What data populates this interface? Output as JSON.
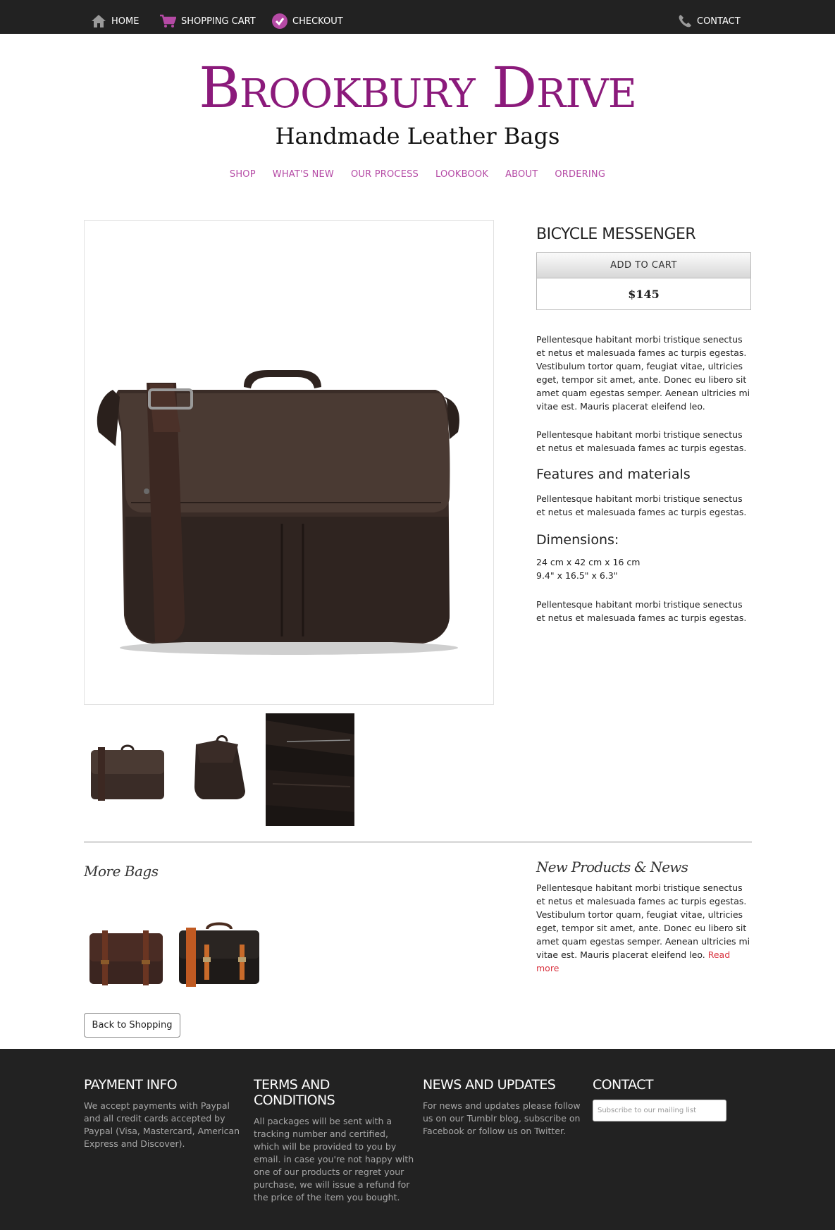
{
  "topnav": {
    "home": "HOME",
    "cart": "SHOPPING CART",
    "checkout": "CHECKOUT",
    "contact": "CONTACT"
  },
  "header": {
    "title": "Brookbury Drive",
    "subtitle": "Handmade Leather Bags"
  },
  "mainnav": [
    "SHOP",
    "WHAT'S NEW",
    "OUR PROCESS",
    "LOOKBOOK",
    "ABOUT",
    "ORDERING"
  ],
  "product": {
    "title": "BICYCLE MESSENGER",
    "add_to_cart": "ADD TO CART",
    "price": "$145",
    "para1": "Pellentesque habitant morbi tristique senectus et netus et malesuada fames ac turpis egestas. Vestibulum tortor quam, feugiat vitae, ultricies eget, tempor sit amet, ante. Donec eu libero sit amet quam egestas semper. Aenean ultricies mi vitae est. Mauris placerat eleifend leo.",
    "para2": "Pellentesque habitant morbi tristique senectus et netus et malesuada fames ac turpis egestas.",
    "features_heading": "Features and materials",
    "para3": "Pellentesque habitant morbi tristique senectus et netus et malesuada fames ac turpis egestas.",
    "dimensions_heading": "Dimensions:",
    "dim_metric": "24 cm x 42 cm x 16 cm",
    "dim_imperial": "9.4\" x 16.5\" x 6.3\"",
    "para4": "Pellentesque habitant morbi tristique senectus et netus et malesuada fames ac turpis egestas."
  },
  "more_bags": {
    "title": "More Bags",
    "back_button": "Back to Shopping"
  },
  "news": {
    "title": "New Products & News",
    "text": "Pellentesque habitant morbi tristique senectus et netus et malesuada fames ac turpis egestas. Vestibulum tortor quam, feugiat vitae, ultricies eget, tempor sit amet, ante. Donec eu libero sit amet quam egestas semper. Aenean ultricies mi vitae est. Mauris placerat eleifend leo.",
    "read_more": "Read more"
  },
  "footer": {
    "payment_title": "PAYMENT INFO",
    "payment_text": "We accept payments with Paypal and all credit cards accepted by Paypal (Visa, Mastercard, American Express and Discover).",
    "terms_title": "TERMS AND CONDITIONS",
    "terms_text": "All packages will be sent with a tracking number and certified, which will be provided to you by email. in case you're not happy with one of our products or regret your purchase, we will issue a refund for the price of the item you bought.",
    "news_title": "NEWS AND UPDATES",
    "news_text": "For news and updates please follow us on our Tumblr blog, subscribe on Facebook or follow us on Twitter.",
    "contact_title": "CONTACT",
    "subscribe_placeholder": "Subscribe to our mailing list"
  },
  "colors": {
    "brand": "#8b1a7b",
    "nav_link": "#b54aa5",
    "topbar": "#222222",
    "read_more": "#d9333f"
  },
  "icons": {
    "home": "home-icon",
    "cart": "cart-icon",
    "checkout": "check-circle-icon",
    "contact": "phone-icon"
  }
}
